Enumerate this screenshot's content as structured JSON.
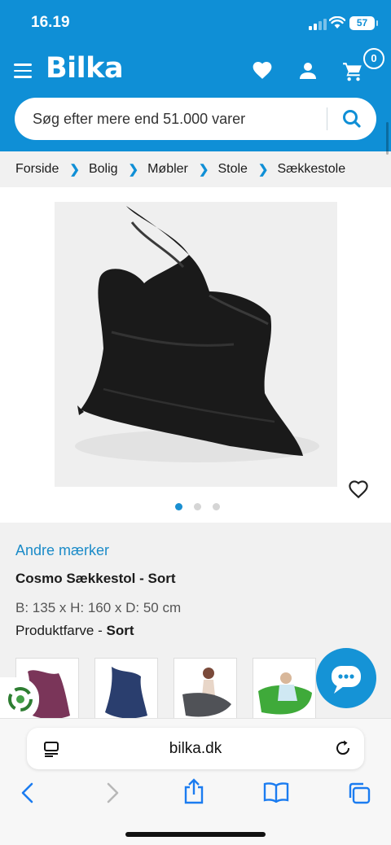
{
  "status_bar": {
    "time": "16.19",
    "battery": "57"
  },
  "header": {
    "logo": "Bilka",
    "cart_count": "0",
    "search_placeholder": "Søg efter mere end 51.000 varer"
  },
  "breadcrumb": [
    "Forside",
    "Bolig",
    "Møbler",
    "Stole",
    "Sækkestole"
  ],
  "gallery": {
    "image_count": 3,
    "active_index": 0
  },
  "product": {
    "brand": "Andre mærker",
    "title": "Cosmo Sækkestol - Sort",
    "dimensions": "B: 135 x H: 160 x D: 50 cm",
    "color_label": "Produktfarve - ",
    "color_value": "Sort",
    "variant_colors": [
      "#7a3559",
      "#2a3e6e",
      "#505257",
      "#3faa3a"
    ]
  },
  "browser": {
    "url": "bilka.dk"
  },
  "colors": {
    "brand_blue": "#0f8fd6",
    "link_blue": "#1b8bc8"
  }
}
